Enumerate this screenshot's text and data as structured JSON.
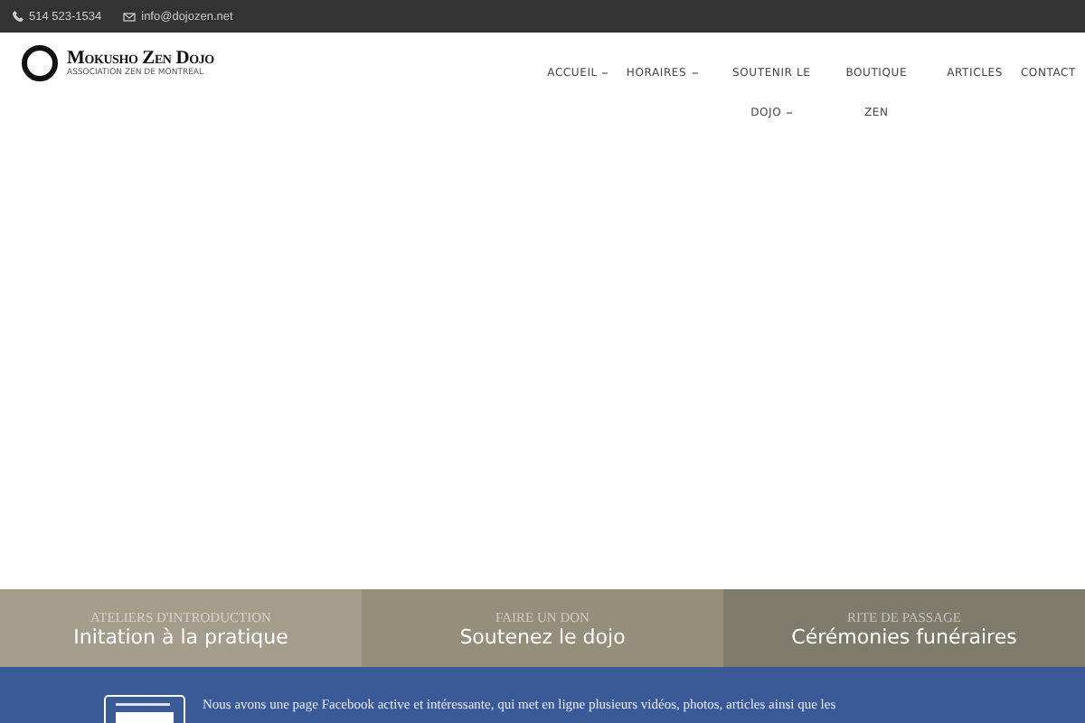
{
  "top_bar": {
    "phone": "514 523-1534",
    "email": "info@dojozen.net"
  },
  "logo": {
    "title": "Mokusho Zen Dojo",
    "subtitle": "ASSOCIATION ZEN DE MONTREAL"
  },
  "nav": [
    {
      "label": "ACCUEIL",
      "has_dropdown": true
    },
    {
      "label": "HORAIRES",
      "has_dropdown": true
    },
    {
      "label": "SOUTENIR LE DOJO",
      "has_dropdown": true
    },
    {
      "label": "BOUTIQUE ZEN",
      "has_dropdown": false
    },
    {
      "label": "ARTICLES",
      "has_dropdown": false
    },
    {
      "label": "CONTACT",
      "has_dropdown": false
    }
  ],
  "promos": [
    {
      "overline": "ATELIERS D'INTRODUCTION",
      "title": "Initation à la pratique",
      "color": "#a59d8b"
    },
    {
      "overline": "FAIRE UN DON",
      "title": "Soutenez le dojo",
      "color": "#958e7b"
    },
    {
      "overline": "RITE DE PASSAGE",
      "title": "Cérémonies funéraires",
      "color": "#7f7b6b"
    }
  ],
  "facebook_band": {
    "text": "Nous avons une page Facebook active et intéressante, qui met en ligne plusieurs vidéos, photos, articles ainsi que les"
  }
}
